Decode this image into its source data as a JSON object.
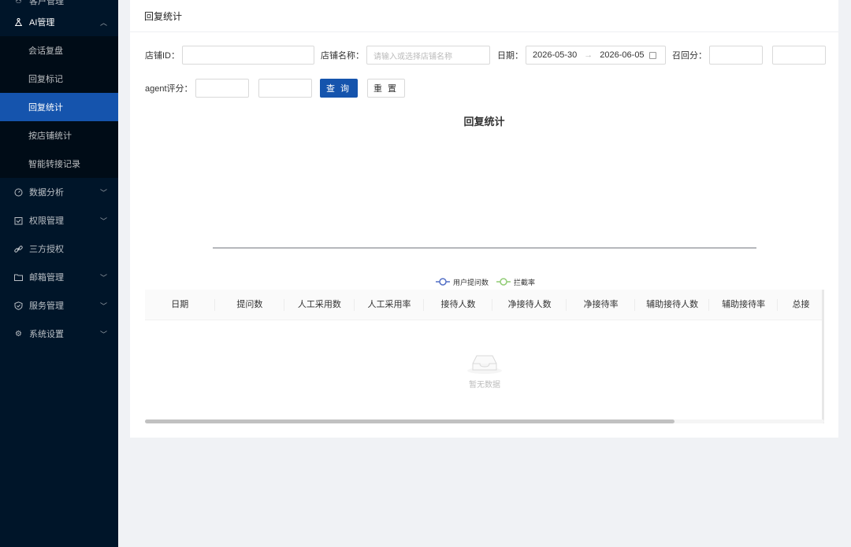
{
  "sidebar": {
    "top_partial": "客户管理",
    "ai_menu": {
      "label": "AI管理",
      "icon": "cluster-icon"
    },
    "ai_sub": [
      {
        "label": "会话复盘"
      },
      {
        "label": "回复标记"
      },
      {
        "label": "回复统计",
        "active": true
      },
      {
        "label": "按店铺统计"
      },
      {
        "label": "智能转接记录"
      }
    ],
    "menus": [
      {
        "label": "数据分析",
        "icon": "dashboard-icon"
      },
      {
        "label": "权限管理",
        "icon": "audit-icon"
      },
      {
        "label": "三方授权",
        "icon": "link-icon"
      },
      {
        "label": "邮箱管理",
        "icon": "folder-icon"
      },
      {
        "label": "服务管理",
        "icon": "shield-icon"
      },
      {
        "label": "系统设置",
        "icon": "setting-icon"
      }
    ]
  },
  "page": {
    "title": "回复统计"
  },
  "filters": {
    "shop_id_label": "店铺ID：",
    "shop_name_label": "店铺名称：",
    "shop_name_placeholder": "请输入或选择店铺名称",
    "date_label": "日期：",
    "date_start": "2026-05-30",
    "date_arrow": "→",
    "date_end": "2026-06-05",
    "recall_label": "召回分：",
    "agent_label": "agent评分：",
    "query_button": "查 询",
    "reset_button": "重 置"
  },
  "chart_data": {
    "type": "line",
    "title": "回复统计",
    "categories": [],
    "series": [
      {
        "name": "用户提问数",
        "values": [],
        "color": "#5470c6"
      },
      {
        "name": "拦截率",
        "values": [],
        "color": "#91cc75"
      }
    ],
    "legend_position": "bottom"
  },
  "table": {
    "columns": [
      "日期",
      "提问数",
      "人工采用数",
      "人工采用率",
      "接待人数",
      "净接待人数",
      "净接待率",
      "辅助接待人数",
      "辅助接待率",
      "总接"
    ],
    "rows": [],
    "empty_text": "暂无数据"
  }
}
